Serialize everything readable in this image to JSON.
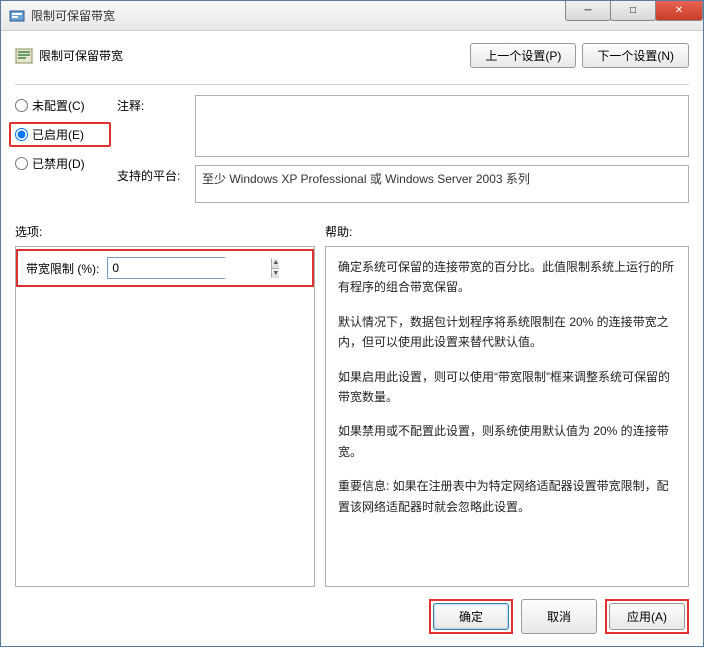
{
  "window": {
    "title": "限制可保留带宽"
  },
  "header": {
    "policy_title": "限制可保留带宽",
    "prev_button": "上一个设置(P)",
    "next_button": "下一个设置(N)"
  },
  "radios": {
    "not_configured": "未配置(C)",
    "enabled": "已启用(E)",
    "disabled": "已禁用(D)"
  },
  "labels": {
    "comment": "注释:",
    "platform": "支持的平台:",
    "options": "选项:",
    "help": "帮助:",
    "bandwidth_limit": "带宽限制 (%):"
  },
  "platform_text": "至少 Windows XP Professional 或 Windows Server 2003 系列",
  "options": {
    "bandwidth_value": "0"
  },
  "help_text": {
    "p1": "确定系统可保留的连接带宽的百分比。此值限制系统上运行的所有程序的组合带宽保留。",
    "p2": "默认情况下，数据包计划程序将系统限制在 20% 的连接带宽之内，但可以使用此设置来替代默认值。",
    "p3": "如果启用此设置，则可以使用“带宽限制”框来调整系统可保留的带宽数量。",
    "p4": "如果禁用或不配置此设置，则系统使用默认值为 20% 的连接带宽。",
    "p5": "重要信息: 如果在注册表中为特定网络适配器设置带宽限制，配置该网络适配器时就会忽略此设置。"
  },
  "footer": {
    "ok": "确定",
    "cancel": "取消",
    "apply": "应用(A)"
  }
}
